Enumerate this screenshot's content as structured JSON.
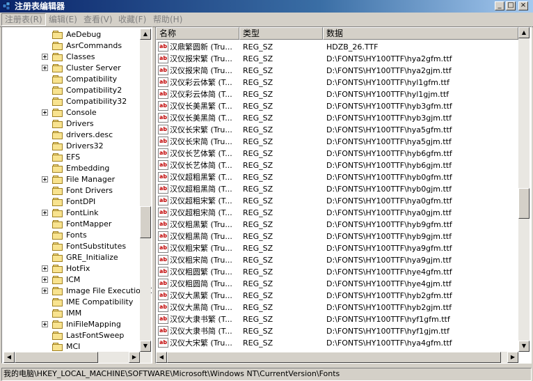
{
  "window": {
    "title": "注册表编辑器",
    "buttons": {
      "minimize": "_",
      "maximize": "□",
      "close": "×"
    }
  },
  "menu": [
    {
      "label": "注册表(R)"
    },
    {
      "label": "编辑(E)"
    },
    {
      "label": "查看(V)"
    },
    {
      "label": "收藏(F)"
    },
    {
      "label": "帮助(H)"
    }
  ],
  "tree": {
    "items": [
      {
        "label": "AeDebug",
        "expandable": false
      },
      {
        "label": "AsrCommands",
        "expandable": false
      },
      {
        "label": "Classes",
        "expandable": true
      },
      {
        "label": "Cluster Server",
        "expandable": true
      },
      {
        "label": "Compatibility",
        "expandable": false
      },
      {
        "label": "Compatibility2",
        "expandable": false
      },
      {
        "label": "Compatibility32",
        "expandable": false
      },
      {
        "label": "Console",
        "expandable": true
      },
      {
        "label": "Drivers",
        "expandable": false
      },
      {
        "label": "drivers.desc",
        "expandable": false
      },
      {
        "label": "Drivers32",
        "expandable": false
      },
      {
        "label": "EFS",
        "expandable": false
      },
      {
        "label": "Embedding",
        "expandable": false
      },
      {
        "label": "File Manager",
        "expandable": true
      },
      {
        "label": "Font Drivers",
        "expandable": false
      },
      {
        "label": "FontDPI",
        "expandable": false
      },
      {
        "label": "FontLink",
        "expandable": true
      },
      {
        "label": "FontMapper",
        "expandable": false
      },
      {
        "label": "Fonts",
        "expandable": false,
        "open": true
      },
      {
        "label": "FontSubstitutes",
        "expandable": false
      },
      {
        "label": "GRE_Initialize",
        "expandable": false
      },
      {
        "label": "HotFix",
        "expandable": true
      },
      {
        "label": "ICM",
        "expandable": true
      },
      {
        "label": "Image File Execution O",
        "expandable": true
      },
      {
        "label": "IME Compatibility",
        "expandable": false
      },
      {
        "label": "IMM",
        "expandable": false
      },
      {
        "label": "IniFileMapping",
        "expandable": true
      },
      {
        "label": "LastFontSweep",
        "expandable": false
      },
      {
        "label": "MCI",
        "expandable": false
      }
    ],
    "scroll_position": 0.62
  },
  "list": {
    "columns": [
      "名称",
      "类型",
      "数据"
    ],
    "rows": [
      {
        "name": "汉鼎繁圆新 (Tru...",
        "type": "REG_SZ",
        "data": "HDZB_26.TTF"
      },
      {
        "name": "汉仪报宋繁 (Tru...",
        "type": "REG_SZ",
        "data": "D:\\FONTS\\HY100TTF\\hya2gfm.ttf"
      },
      {
        "name": "汉仪报宋简 (Tru...",
        "type": "REG_SZ",
        "data": "D:\\FONTS\\HY100TTF\\hya2gjm.ttf"
      },
      {
        "name": "汉仪彩云体繁 (T...",
        "type": "REG_SZ",
        "data": "D:\\FONTS\\HY100TTF\\hyl1gfm.ttf"
      },
      {
        "name": "汉仪彩云体简 (T...",
        "type": "REG_SZ",
        "data": "D:\\FONTS\\HY100TTF\\hyl1gjm.ttf"
      },
      {
        "name": "汉仪长美黑繁 (T...",
        "type": "REG_SZ",
        "data": "D:\\FONTS\\HY100TTF\\hyb3gfm.ttf"
      },
      {
        "name": "汉仪长美黑简 (T...",
        "type": "REG_SZ",
        "data": "D:\\FONTS\\HY100TTF\\hyb3gjm.ttf"
      },
      {
        "name": "汉仪长宋繁 (Tru...",
        "type": "REG_SZ",
        "data": "D:\\FONTS\\HY100TTF\\hya5gfm.ttf"
      },
      {
        "name": "汉仪长宋简 (Tru...",
        "type": "REG_SZ",
        "data": "D:\\FONTS\\HY100TTF\\hya5gjm.ttf"
      },
      {
        "name": "汉仪长艺体繁 (T...",
        "type": "REG_SZ",
        "data": "D:\\FONTS\\HY100TTF\\hyb6gfm.ttf"
      },
      {
        "name": "汉仪长艺体简 (T...",
        "type": "REG_SZ",
        "data": "D:\\FONTS\\HY100TTF\\hyb6gjm.ttf"
      },
      {
        "name": "汉仪超粗黑繁 (T...",
        "type": "REG_SZ",
        "data": "D:\\FONTS\\HY100TTF\\hyb0gfm.ttf"
      },
      {
        "name": "汉仪超粗黑简 (T...",
        "type": "REG_SZ",
        "data": "D:\\FONTS\\HY100TTF\\hyb0gjm.ttf"
      },
      {
        "name": "汉仪超粗宋繁 (T...",
        "type": "REG_SZ",
        "data": "D:\\FONTS\\HY100TTF\\hya0gfm.ttf"
      },
      {
        "name": "汉仪超粗宋简 (T...",
        "type": "REG_SZ",
        "data": "D:\\FONTS\\HY100TTF\\hya0gjm.ttf"
      },
      {
        "name": "汉仪粗黑繁 (Tru...",
        "type": "REG_SZ",
        "data": "D:\\FONTS\\HY100TTF\\hyb9gfm.ttf"
      },
      {
        "name": "汉仪粗黑简 (Tru...",
        "type": "REG_SZ",
        "data": "D:\\FONTS\\HY100TTF\\hyb9gjm.ttf"
      },
      {
        "name": "汉仪粗宋繁 (Tru...",
        "type": "REG_SZ",
        "data": "D:\\FONTS\\HY100TTF\\hya9gfm.ttf"
      },
      {
        "name": "汉仪粗宋简 (Tru...",
        "type": "REG_SZ",
        "data": "D:\\FONTS\\HY100TTF\\hya9gjm.ttf"
      },
      {
        "name": "汉仪粗圆繁 (Tru...",
        "type": "REG_SZ",
        "data": "D:\\FONTS\\HY100TTF\\hye4gfm.ttf"
      },
      {
        "name": "汉仪粗圆简 (Tru...",
        "type": "REG_SZ",
        "data": "D:\\FONTS\\HY100TTF\\hye4gjm.ttf"
      },
      {
        "name": "汉仪大黑繁 (Tru...",
        "type": "REG_SZ",
        "data": "D:\\FONTS\\HY100TTF\\hyb2gfm.ttf"
      },
      {
        "name": "汉仪大黑简 (Tru...",
        "type": "REG_SZ",
        "data": "D:\\FONTS\\HY100TTF\\hyb2gjm.ttf"
      },
      {
        "name": "汉仪大隶书繁 (T...",
        "type": "REG_SZ",
        "data": "D:\\FONTS\\HY100TTF\\hyf1gfm.ttf"
      },
      {
        "name": "汉仪大隶书简 (T...",
        "type": "REG_SZ",
        "data": "D:\\FONTS\\HY100TTF\\hyf1gjm.ttf"
      },
      {
        "name": "汉仪大宋繁 (Tru...",
        "type": "REG_SZ",
        "data": "D:\\FONTS\\HY100TTF\\hya4gfm.ttf"
      }
    ],
    "scroll_position": 0.55
  },
  "status": {
    "path": "我的电脑\\HKEY_LOCAL_MACHINE\\SOFTWARE\\Microsoft\\Windows NT\\CurrentVersion\\Fonts"
  },
  "icons": {
    "value": "ab",
    "scroll_up": "▲",
    "scroll_down": "▼",
    "scroll_left": "◀",
    "scroll_right": "▶"
  },
  "colors": {
    "titlebar": "#0a246a",
    "window": "#d4d0c8",
    "folder": "#f8e38f",
    "value_icon": "#c00000"
  }
}
